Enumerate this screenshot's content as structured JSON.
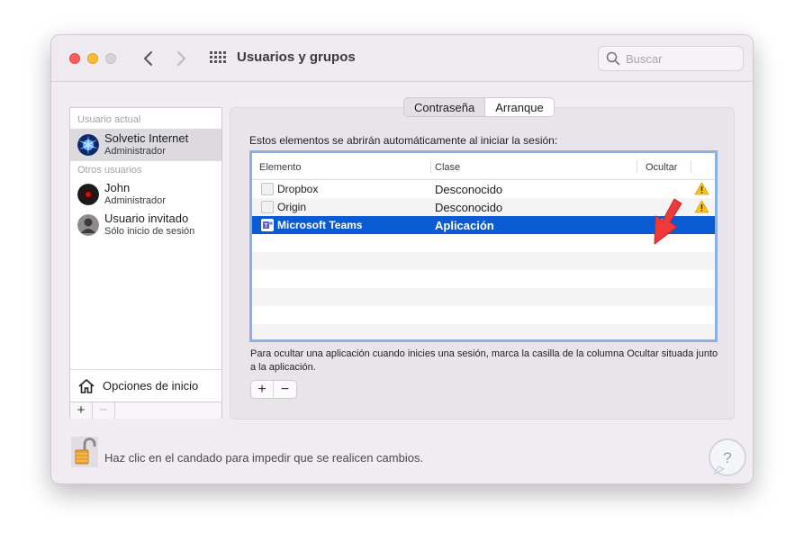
{
  "window": {
    "title": "Usuarios y grupos",
    "search_placeholder": "Buscar"
  },
  "sidebar": {
    "current_header": "Usuario actual",
    "others_header": "Otros usuarios",
    "users": [
      {
        "name": "Solvetic Internet",
        "role": "Administrador",
        "selected": true
      },
      {
        "name": "John",
        "role": "Administrador"
      },
      {
        "name": "Usuario invitado",
        "role": "Sólo inicio de sesión"
      }
    ],
    "login_options": "Opciones de inicio",
    "add": "+",
    "remove": "−"
  },
  "tabs": [
    "Contraseña",
    "Arranque"
  ],
  "active_tab": "Arranque",
  "login_items": {
    "intro": "Estos elementos se abrirán automáticamente al iniciar la sesión:",
    "columns": [
      "Elemento",
      "Clase",
      "Ocultar"
    ],
    "rows": [
      {
        "name": "Dropbox",
        "class": "Desconocido",
        "warning": true
      },
      {
        "name": "Origin",
        "class": "Desconocido",
        "warning": true
      },
      {
        "name": "Microsoft Teams",
        "class": "Aplicación",
        "selected": true,
        "hide": false
      }
    ],
    "help": "Para ocultar una aplicación cuando inicies una sesión, marca la casilla de la columna Ocultar situada junto a la aplicación.",
    "add": "+",
    "remove": "−"
  },
  "lock_text": "Haz clic en el candado para impedir que se realicen cambios.",
  "colors": {
    "selection": "#0a5bd3",
    "table_focus": "#8ab0ea",
    "warning": "#f7c21b",
    "arrow": "#ee3a3a"
  }
}
